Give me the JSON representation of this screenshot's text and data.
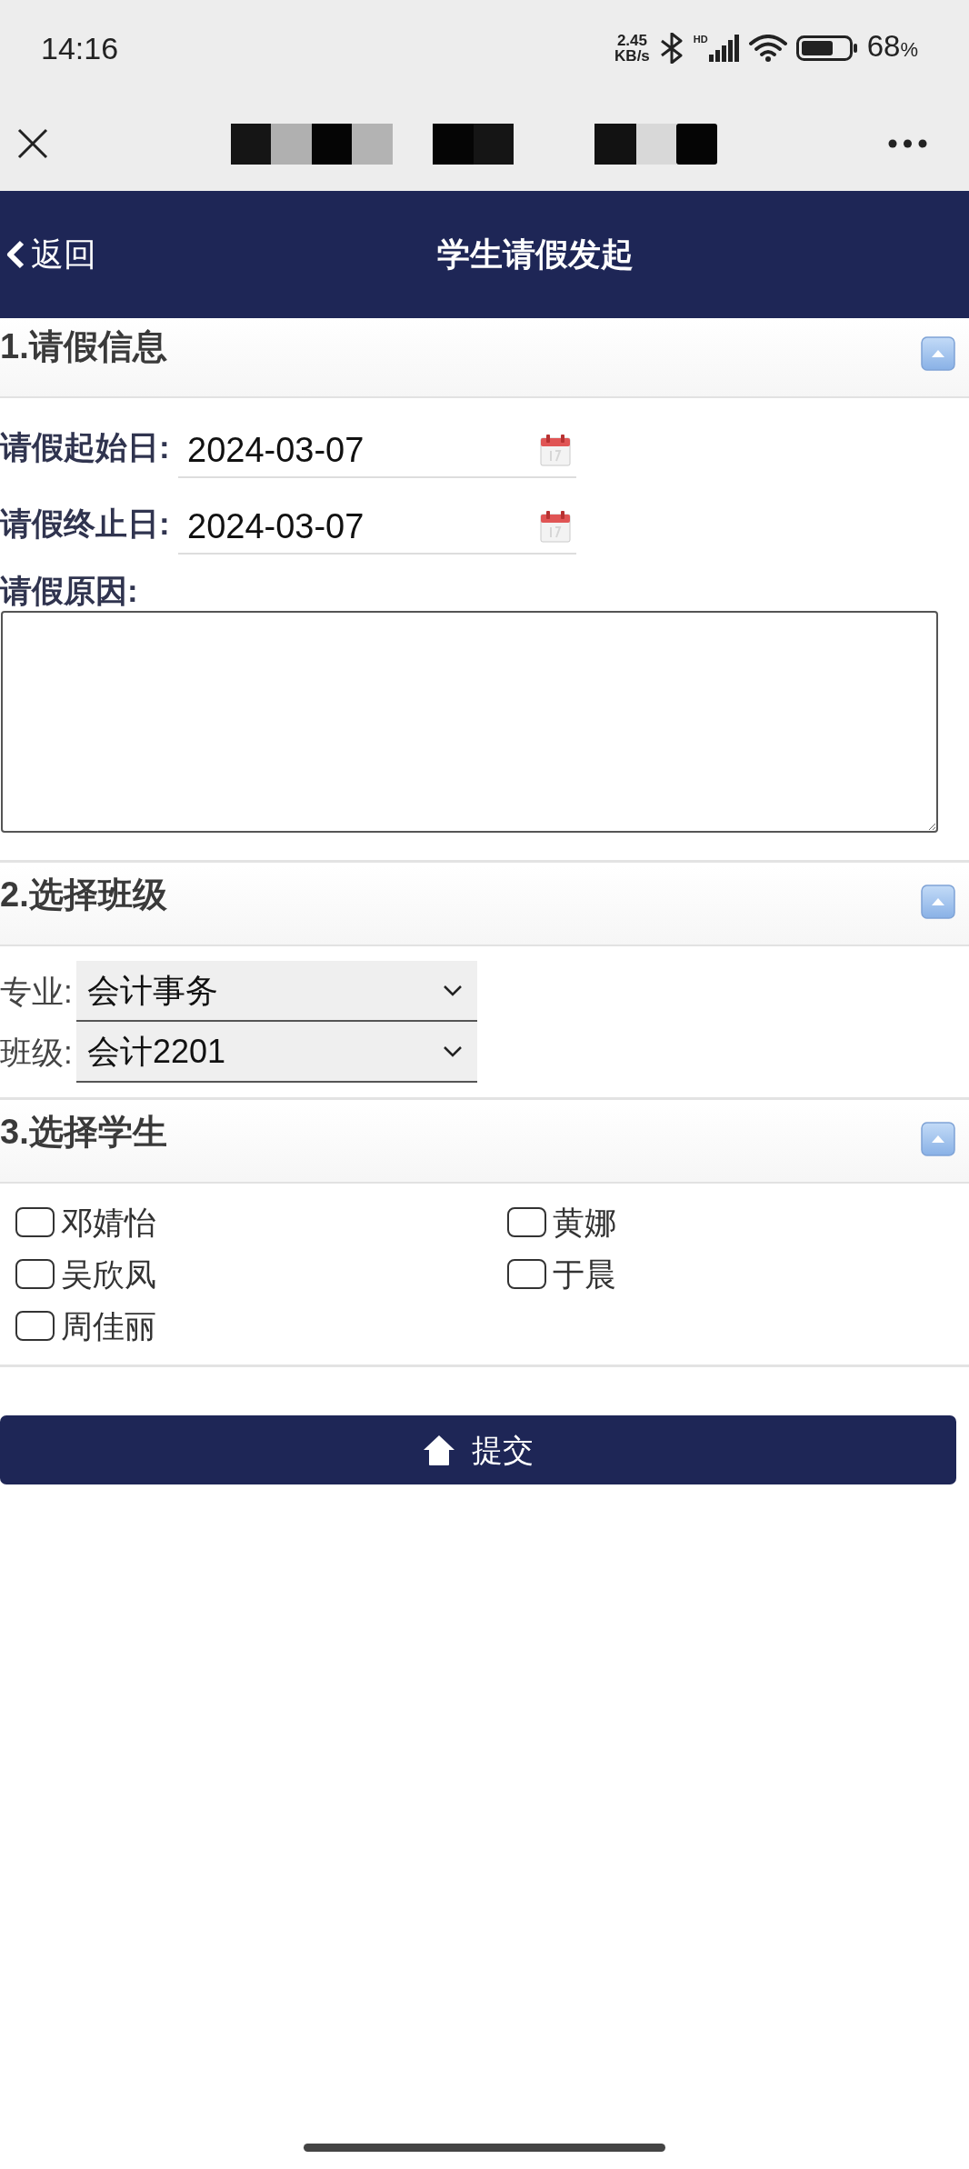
{
  "status_bar": {
    "time": "14:16",
    "net_speed_value": "2.45",
    "net_speed_unit": "KB/s",
    "signal_label": "HD",
    "battery_value": "68",
    "battery_unit": "%"
  },
  "header": {
    "back_label": "返回",
    "title": "学生请假发起"
  },
  "sections": [
    {
      "title": "1.请假信息",
      "expanded": true,
      "fields": [
        {
          "kind": "date",
          "label": "请假起始日:",
          "value": "2024-03-07"
        },
        {
          "kind": "date",
          "label": "请假终止日:",
          "value": "2024-03-07"
        },
        {
          "kind": "textarea",
          "label": "请假原因:"
        }
      ]
    },
    {
      "title": "2.选择班级",
      "expanded": true,
      "fields": [
        {
          "kind": "select",
          "label": "专业:",
          "value": "会计事务"
        },
        {
          "kind": "select",
          "label": "班级:",
          "value": "会计2201"
        }
      ]
    },
    {
      "title": "3.选择学生",
      "expanded": true,
      "fields": [
        {
          "kind": "checkbox",
          "label": "邓婧怡",
          "checked": false
        },
        {
          "kind": "checkbox",
          "label": "黄娜",
          "checked": false
        },
        {
          "kind": "checkbox",
          "label": "吴欣凤",
          "checked": false
        },
        {
          "kind": "checkbox",
          "label": "于晨",
          "checked": false
        },
        {
          "kind": "checkbox",
          "label": "周佳丽",
          "checked": false
        }
      ]
    }
  ],
  "submit_button": {
    "label": "提交"
  }
}
